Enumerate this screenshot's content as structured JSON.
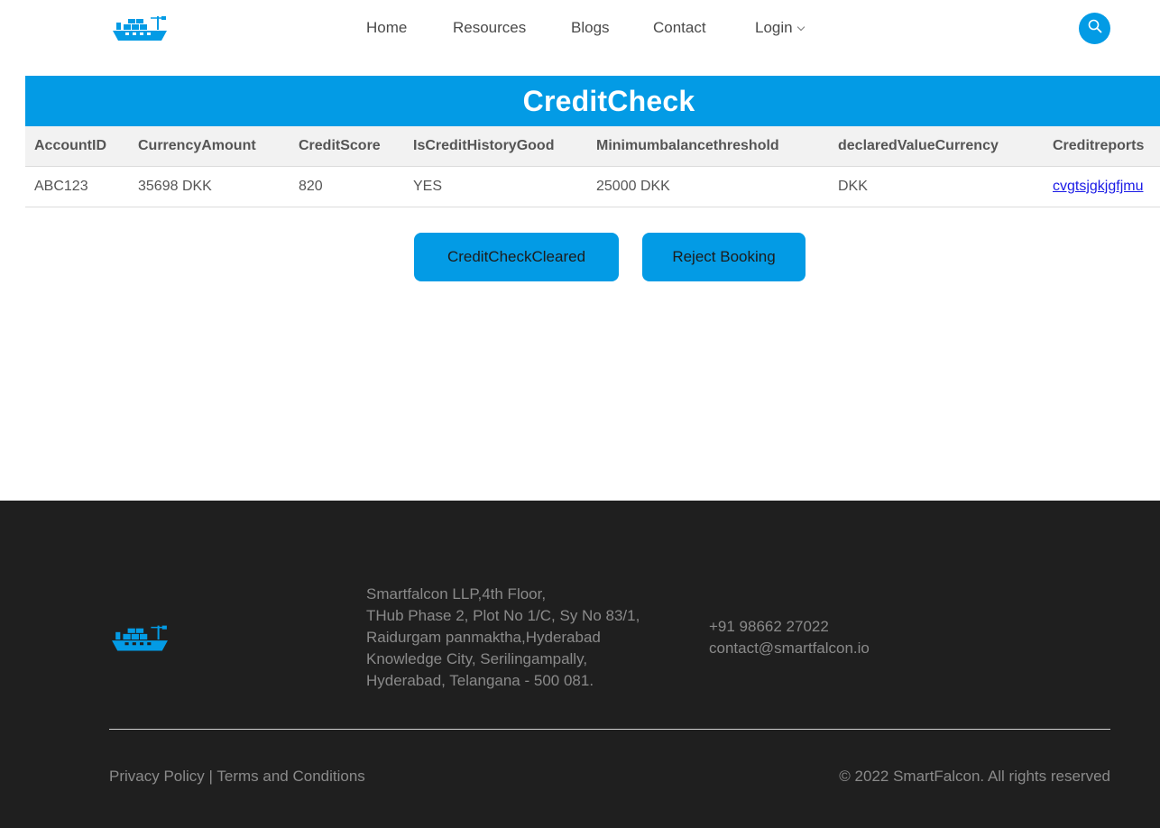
{
  "header": {
    "logo_icon": "cargo-ship-icon",
    "nav": [
      {
        "label": "Home"
      },
      {
        "label": "Resources"
      },
      {
        "label": "Blogs"
      },
      {
        "label": "Contact"
      },
      {
        "label": "Login"
      }
    ],
    "search_icon": "search-icon"
  },
  "page": {
    "title": "CreditCheck"
  },
  "table": {
    "columns": [
      "AccountID",
      "CurrencyAmount",
      "CreditScore",
      "IsCreditHistoryGood",
      "Minimumbalancethreshold",
      "declaredValueCurrency",
      "Creditreports"
    ],
    "row": {
      "account_id": "ABC123",
      "currency_amount": "35698 DKK",
      "credit_score": "820",
      "is_credit_history_good": "YES",
      "minimum_balance_threshold": "25000 DKK",
      "declared_value_currency": "DKK",
      "credit_reports": "cvgtsjgkjgfjmu"
    }
  },
  "actions": {
    "clear_label": "CreditCheckCleared",
    "reject_label": "Reject Booking"
  },
  "footer": {
    "address_lines": [
      "Smartfalcon LLP,4th Floor,",
      "THub Phase 2, Plot No 1/C, Sy No 83/1,",
      "Raidurgam panmaktha,Hyderabad",
      "Knowledge City, Serilingampally,",
      "Hyderabad, Telangana - 500 081."
    ],
    "phone": "+91 98662 27022",
    "email": "contact@smartfalcon.io",
    "privacy_label": "Privacy Policy",
    "separator": " | ",
    "terms_label": "Terms and Conditions",
    "copyright": "© 2022 SmartFalcon. All rights reserved"
  },
  "colors": {
    "accent": "#039be5",
    "footer_bg": "#1f1f1f",
    "link": "#1a1ae6"
  }
}
